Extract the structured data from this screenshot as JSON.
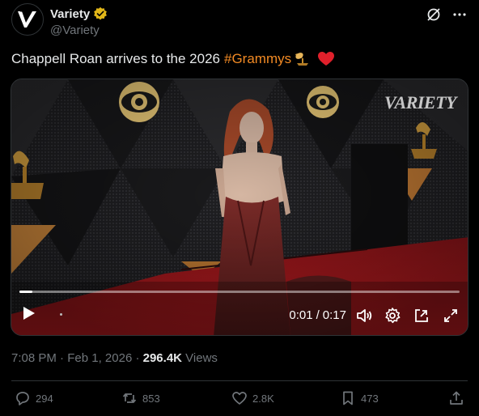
{
  "author": {
    "name": "Variety",
    "handle": "@Variety",
    "avatar_letter": "V",
    "verified_color": "#e2b719"
  },
  "tweet": {
    "text": "Chappell Roan arrives to the 2026",
    "hashtag": "#Grammys",
    "emojis": [
      "gramophone-icon",
      "red-heart-icon"
    ]
  },
  "video": {
    "watermark": "VARIETY",
    "current_time": "0:01",
    "separator": "/",
    "duration": "0:17",
    "progress_fraction": 0.03
  },
  "meta": {
    "time": "7:08 PM",
    "date": "Feb 1, 2026",
    "views_count": "296.4K",
    "views_label": "Views"
  },
  "actions": {
    "replies": "294",
    "reposts": "853",
    "likes": "2.8K",
    "bookmarks": "473"
  },
  "colors": {
    "hashtag": "#f28a24",
    "muted": "#71767b",
    "text": "#e7e9ea",
    "heart": "#f91880"
  }
}
